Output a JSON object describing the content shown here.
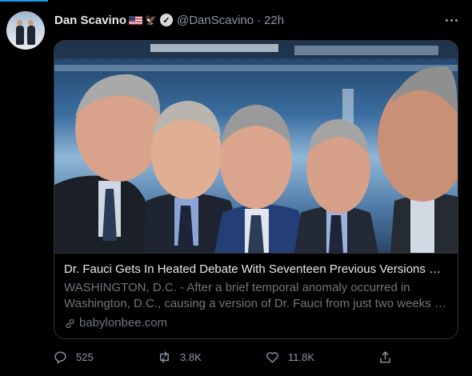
{
  "tweet": {
    "author_name": "Dan Scavino",
    "author_handle": "@DanScavino",
    "separator": "·",
    "time": "22h",
    "flag_emoji_icon": "us-flag-icon",
    "eagle_icon": "eagle-icon",
    "verified_icon": "verified-badge-icon"
  },
  "card": {
    "title": "Dr. Fauci Gets In Heated Debate With Seventeen Previous Versions Of ...",
    "description_line1": "WASHINGTON, D.C. - After a brief temporal anomaly occurred in",
    "description_line2": "Washington, D.C., causing a version of Dr. Fauci from just two weeks a...",
    "domain": "babylonbee.com"
  },
  "actions": {
    "replies": "525",
    "retweets": "3.8K",
    "likes": "11.8K"
  },
  "colors": {
    "accent": "#1d9bf0",
    "text_primary": "#e7e9ea",
    "text_secondary": "#8b98a5",
    "border": "#2f3336"
  }
}
